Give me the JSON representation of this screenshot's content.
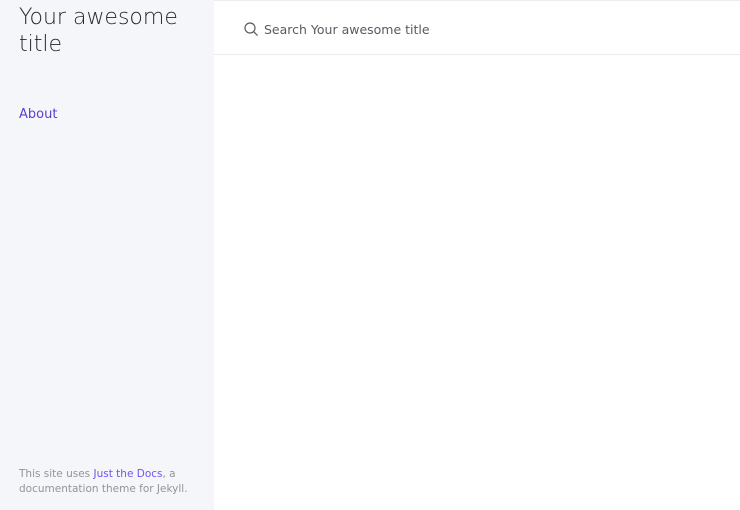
{
  "sidebar": {
    "site_title": "Your awesome title",
    "nav": [
      {
        "label": "About"
      }
    ],
    "footer": {
      "prefix": "This site uses ",
      "link_text": "Just the Docs",
      "suffix": ", a documentation theme for Jekyll."
    }
  },
  "header": {
    "search": {
      "placeholder": "Search Your awesome title",
      "value": ""
    }
  },
  "colors": {
    "accent": "#7253ed",
    "sidebar_bg": "#f5f6fa",
    "text": "#27262b"
  }
}
